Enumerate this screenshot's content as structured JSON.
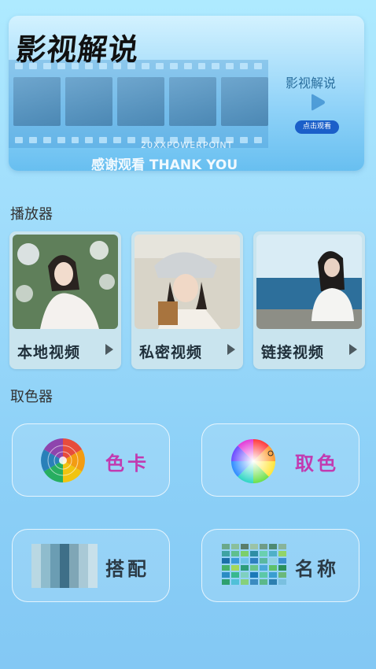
{
  "banner": {
    "title": "影视解说",
    "side_title": "影视解说",
    "watch_button": "点击观看",
    "subtitle": "20XXPOWERPOINT",
    "thanks": "感谢观看 THANK YOU"
  },
  "player": {
    "section_title": "播放器",
    "cards": [
      {
        "label": "本地视频"
      },
      {
        "label": "私密视频"
      },
      {
        "label": "链接视频"
      }
    ]
  },
  "color_picker": {
    "section_title": "取色器",
    "tools": [
      {
        "label": "色卡",
        "icon": "color-wheel-segmented-icon",
        "label_color": "#c23ab0"
      },
      {
        "label": "取色",
        "icon": "color-wheel-gradient-icon",
        "label_color": "#c23ab0"
      },
      {
        "label": "搭配",
        "icon": "color-stripes-icon",
        "label_color": "#2b3a45"
      },
      {
        "label": "名称",
        "icon": "color-grid-icon",
        "label_color": "#2b3a45"
      }
    ]
  }
}
